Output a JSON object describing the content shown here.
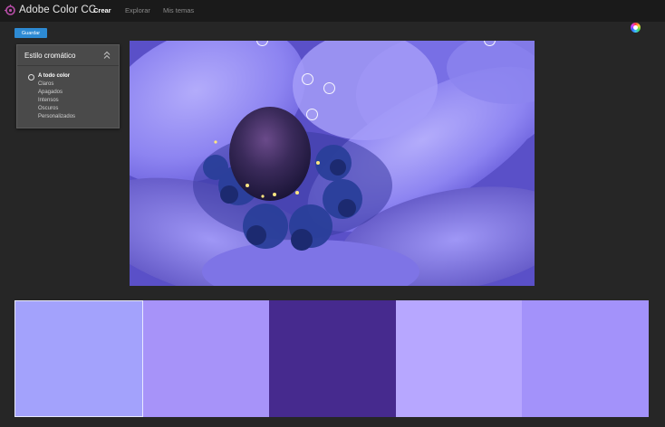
{
  "app": {
    "title": "Adobe Color CC",
    "logo_icon": "adobe-color-logo-icon"
  },
  "nav": {
    "tabs": [
      {
        "label": "Crear",
        "active": true
      },
      {
        "label": "Explorar",
        "active": false
      },
      {
        "label": "Mis temas",
        "active": false
      }
    ]
  },
  "toolbar": {
    "save_label": "Guardar",
    "wheel_icon": "color-wheel-icon"
  },
  "chromatic_panel": {
    "title": "Estilo cromático",
    "options": [
      "A todo color",
      "Claros",
      "Apagados",
      "Intensos",
      "Oscuros",
      "Personalizados"
    ],
    "selected": "A todo color"
  },
  "image": {
    "subject": "purple-anemone-flower"
  },
  "swatches": {
    "colors": [
      "#A3A2FC",
      "#A793F9",
      "#462A8E",
      "#B7A7FF",
      "#A392FA"
    ],
    "active_index": 0
  },
  "colors": {
    "accent": "#2D8AD3",
    "topbar": "#1A1A1A",
    "background": "#262626"
  }
}
